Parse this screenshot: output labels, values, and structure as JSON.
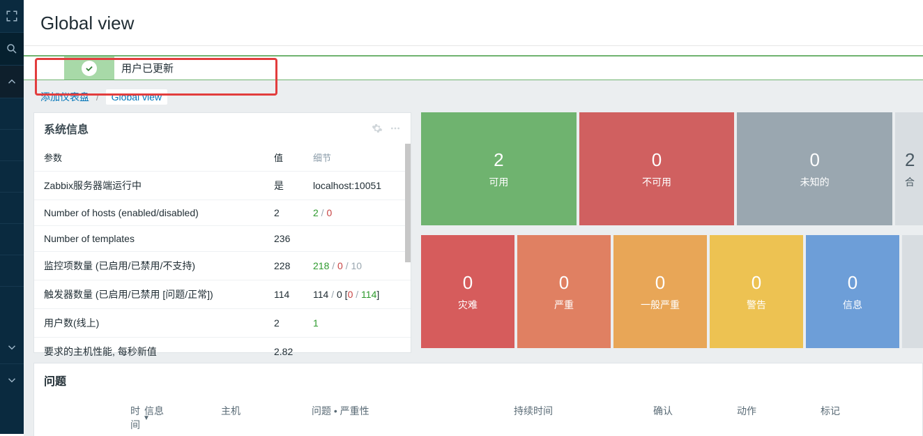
{
  "page": {
    "title": "Global view"
  },
  "sidebar": {
    "icons": [
      "fullscreen",
      "search",
      "chevron-up",
      "chevron-down-1",
      "chevron-down-2"
    ]
  },
  "alert": {
    "message": "用户已更新"
  },
  "breadcrumb": {
    "add_dashboard": "添加仪表盘",
    "current": "Global view"
  },
  "sysinfo": {
    "title": "系统信息",
    "headers": {
      "param": "参数",
      "value": "值",
      "detail": "细节"
    },
    "rows": [
      {
        "param": "Zabbix服务器端运行中",
        "value": "是",
        "value_class": "green",
        "detail": "localhost:10051",
        "detail_parts": null
      },
      {
        "param": "Number of hosts (enabled/disabled)",
        "value": "2",
        "value_class": "",
        "detail": null,
        "detail_parts": [
          {
            "t": "2",
            "c": "green"
          },
          {
            "t": " / ",
            "c": "grey"
          },
          {
            "t": "0",
            "c": "red"
          }
        ]
      },
      {
        "param": "Number of templates",
        "value": "236",
        "value_class": "",
        "detail": "",
        "detail_parts": null
      },
      {
        "param": "监控项数量  (已启用/已禁用/不支持)",
        "value": "228",
        "value_class": "",
        "detail": null,
        "detail_parts": [
          {
            "t": "218",
            "c": "green"
          },
          {
            "t": " / ",
            "c": "grey"
          },
          {
            "t": "0",
            "c": "red"
          },
          {
            "t": " / ",
            "c": "grey"
          },
          {
            "t": "10",
            "c": "grey"
          }
        ]
      },
      {
        "param": "触发器数量  (已启用/已禁用 [问题/正常])",
        "value": "114",
        "value_class": "",
        "detail": null,
        "detail_parts": [
          {
            "t": "114",
            "c": ""
          },
          {
            "t": " / ",
            "c": "grey"
          },
          {
            "t": "0",
            "c": ""
          },
          {
            "t": " [",
            "c": ""
          },
          {
            "t": "0",
            "c": "red"
          },
          {
            "t": " / ",
            "c": "grey"
          },
          {
            "t": "114",
            "c": "green"
          },
          {
            "t": "]",
            "c": ""
          }
        ]
      },
      {
        "param": "用户数(线上)",
        "value": "2",
        "value_class": "",
        "detail": null,
        "detail_parts": [
          {
            "t": "1",
            "c": "green"
          }
        ]
      },
      {
        "param": "要求的主机性能, 每秒新值",
        "value": "2.82",
        "value_class": "",
        "detail": "",
        "detail_parts": null
      }
    ]
  },
  "availability": {
    "tiles": [
      {
        "num": "2",
        "label": "可用",
        "class": "tile-avail"
      },
      {
        "num": "0",
        "label": "不可用",
        "class": "tile-unavail"
      },
      {
        "num": "0",
        "label": "未知的",
        "class": "tile-unknown"
      },
      {
        "num": "2",
        "label": "合",
        "class": "tile-grey tile-dark partial"
      }
    ]
  },
  "severity": {
    "tiles": [
      {
        "num": "0",
        "label": "灾难",
        "class": "sev-disaster"
      },
      {
        "num": "0",
        "label": "严重",
        "class": "sev-high"
      },
      {
        "num": "0",
        "label": "一般严重",
        "class": "sev-average"
      },
      {
        "num": "0",
        "label": "警告",
        "class": "sev-warning"
      },
      {
        "num": "0",
        "label": "信息",
        "class": "sev-info"
      }
    ]
  },
  "problems": {
    "title": "问题",
    "columns": {
      "time": "时间",
      "info": "信息",
      "host": "主机",
      "issue": "问题 • 严重性",
      "duration": "持续时间",
      "ack": "确认",
      "action": "动作",
      "tag": "标记"
    }
  }
}
